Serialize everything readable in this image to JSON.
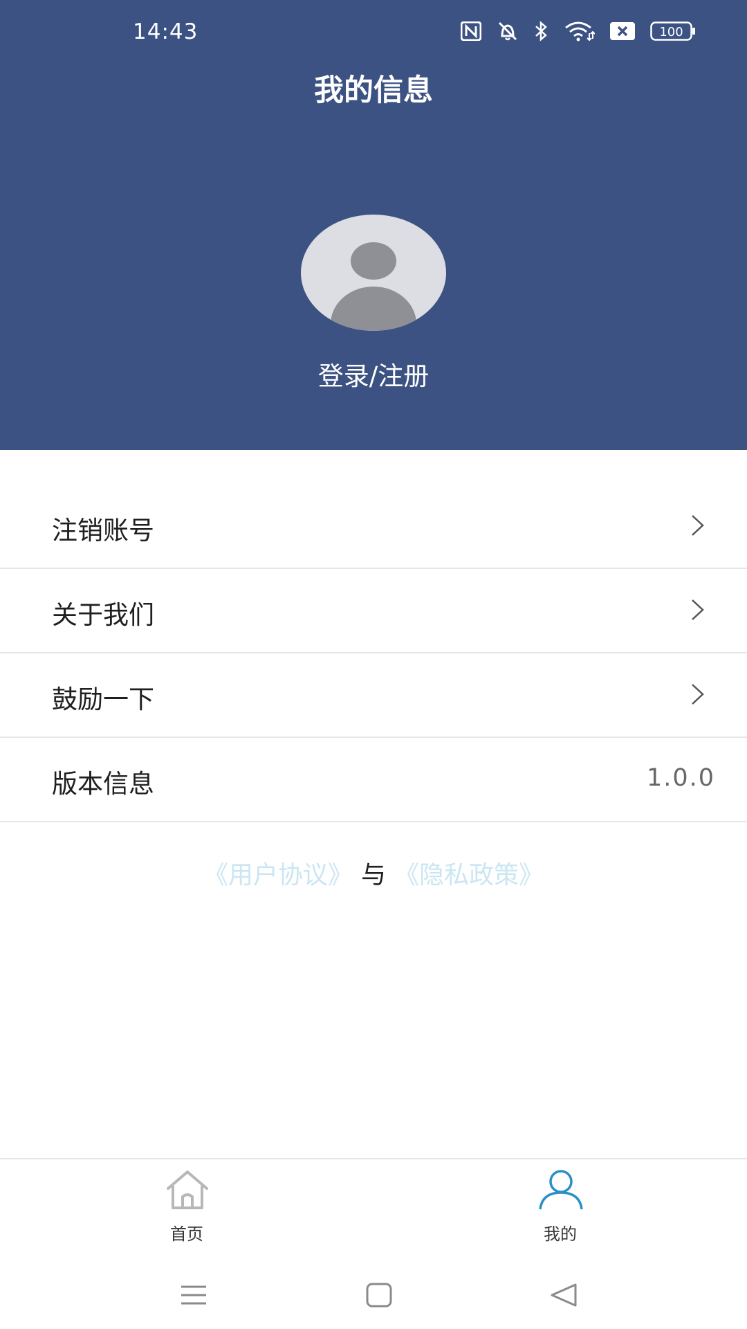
{
  "status_bar": {
    "time": "14:43",
    "battery": "100",
    "icons": [
      "nfc-icon",
      "mute-bell-icon",
      "bluetooth-icon",
      "wifi-icon",
      "sim-off-icon",
      "battery-icon"
    ]
  },
  "header": {
    "title": "我的信息",
    "background_color": "#3c5283",
    "avatar_icon": "user-avatar-icon",
    "login_label": "登录/注册"
  },
  "menu": {
    "items": [
      {
        "label": "注销账号",
        "icon": "chevron-right-icon"
      },
      {
        "label": "关于我们",
        "icon": "chevron-right-icon"
      },
      {
        "label": "鼓励一下",
        "icon": "chevron-right-icon"
      },
      {
        "label": "版本信息",
        "value": "1.0.0"
      }
    ]
  },
  "agreement": {
    "user_agreement": "《用户协议》",
    "separator": "与",
    "privacy_policy": "《隐私政策》",
    "link_color": "#cbe6f3"
  },
  "tabbar": {
    "tabs": [
      {
        "label": "首页",
        "icon": "home-icon",
        "active": false
      },
      {
        "label": "我的",
        "icon": "person-icon",
        "active": true
      }
    ],
    "active_color": "#2a8fc7",
    "inactive_color": "#333333"
  },
  "system_nav": {
    "buttons": [
      "menu-icon",
      "home-square-icon",
      "back-triangle-icon"
    ]
  }
}
